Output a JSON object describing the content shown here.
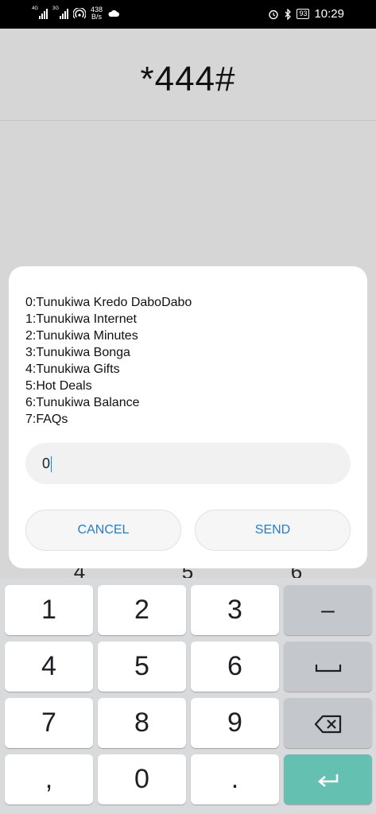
{
  "status_bar": {
    "sim1_tag": "4G",
    "sim2_tag": "3G",
    "net_speed_value": "438",
    "net_speed_unit": "B/s",
    "battery": "93",
    "time": "10:29"
  },
  "dialer": {
    "number": "*444#",
    "peek_keys": [
      "4",
      "5",
      "6"
    ]
  },
  "ussd_dialog": {
    "menu_items": [
      "0:Tunukiwa Kredo DaboDabo",
      "1:Tunukiwa Internet",
      "2:Tunukiwa Minutes",
      "3:Tunukiwa Bonga",
      "4:Tunukiwa Gifts",
      "5:Hot Deals",
      "6:Tunukiwa Balance",
      "7:FAQs"
    ],
    "reply_value": "0",
    "cancel_label": "CANCEL",
    "send_label": "SEND"
  },
  "keyboard": {
    "keys": {
      "k1": "1",
      "k2": "2",
      "k3": "3",
      "minus": "–",
      "k4": "4",
      "k5": "5",
      "k6": "6",
      "k7": "7",
      "k8": "8",
      "k9": "9",
      "comma": ",",
      "k0": "0",
      "period": "."
    },
    "icons": [
      "space-icon",
      "backspace-icon",
      "enter-icon"
    ],
    "enter_color": "#64c0b0"
  }
}
